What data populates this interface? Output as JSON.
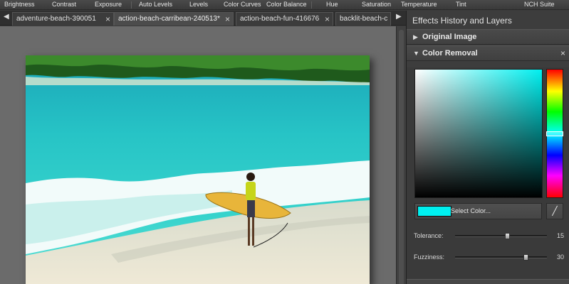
{
  "menu": {
    "items": [
      "Brightness",
      "Contrast",
      "Exposure",
      "Auto Levels",
      "Levels",
      "Color Curves",
      "Color Balance",
      "Hue",
      "Saturation",
      "Temperature",
      "Tint",
      "NCH Suite"
    ]
  },
  "tabs": {
    "items": [
      {
        "label": "adventure-beach-390051",
        "close": "×"
      },
      {
        "label": "action-beach-carribean-240513*",
        "close": "×"
      },
      {
        "label": "action-beach-fun-416676",
        "close": "×"
      },
      {
        "label": "backlit-beach-c",
        "close": ""
      }
    ],
    "active_index": 1,
    "left_arrow": "◀",
    "right_arrow": "▶"
  },
  "panel": {
    "title": "Effects History and Layers",
    "original_image": {
      "label": "Original Image",
      "arrow": "▶"
    },
    "color_removal": {
      "label": "Color Removal",
      "arrow": "▼",
      "close": "×",
      "selected_color": "#00f0f0",
      "select_color_label": "Select Color...",
      "hue_position": 0.5,
      "tolerance": {
        "label": "Tolerance:",
        "value": "15",
        "fraction": 0.15
      },
      "fuzziness": {
        "label": "Fuzziness:",
        "value": "30",
        "fraction": 0.3
      }
    }
  },
  "colors": {
    "accent": "#00f0f0",
    "workspace": "#6b6b6b",
    "panel": "#3d3d3d"
  }
}
